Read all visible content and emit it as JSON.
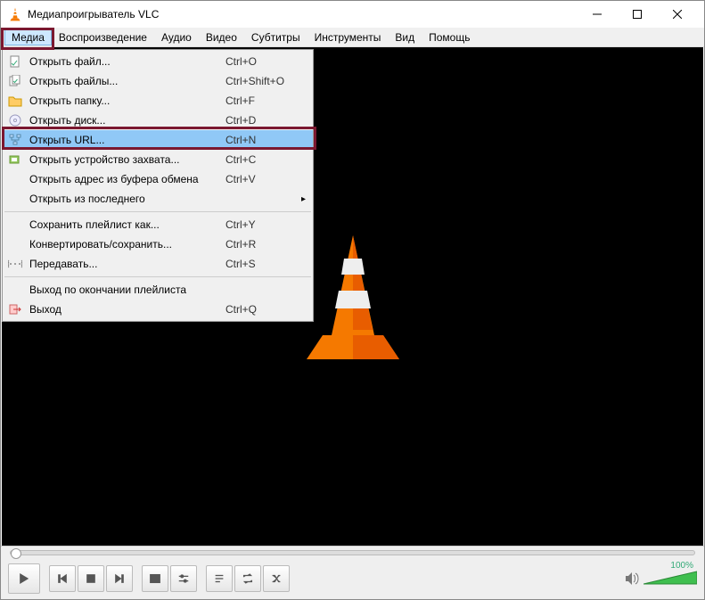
{
  "titlebar": {
    "title": "Медиапроигрыватель VLC"
  },
  "menubar": {
    "items": [
      {
        "label": "Медиа",
        "open": true
      },
      {
        "label": "Воспроизведение"
      },
      {
        "label": "Аудио"
      },
      {
        "label": "Видео"
      },
      {
        "label": "Субтитры"
      },
      {
        "label": "Инструменты"
      },
      {
        "label": "Вид"
      },
      {
        "label": "Помощь"
      }
    ]
  },
  "dropdown": {
    "items": [
      {
        "icon": "file",
        "label": "Открыть файл...",
        "shortcut": "Ctrl+O"
      },
      {
        "icon": "files",
        "label": "Открыть файлы...",
        "shortcut": "Ctrl+Shift+O"
      },
      {
        "icon": "folder",
        "label": "Открыть папку...",
        "shortcut": "Ctrl+F"
      },
      {
        "icon": "disc",
        "label": "Открыть диск...",
        "shortcut": "Ctrl+D"
      },
      {
        "icon": "network",
        "label": "Открыть URL...",
        "shortcut": "Ctrl+N",
        "hover": true,
        "highlighted": true
      },
      {
        "icon": "capture",
        "label": "Открыть устройство захвата...",
        "shortcut": "Ctrl+C"
      },
      {
        "icon": "",
        "label": "Открыть адрес из буфера обмена",
        "shortcut": "Ctrl+V"
      },
      {
        "icon": "",
        "label": "Открыть из последнего",
        "shortcut": "",
        "submenu": true
      },
      {
        "sep": true
      },
      {
        "icon": "",
        "label": "Сохранить плейлист как...",
        "shortcut": "Ctrl+Y"
      },
      {
        "icon": "",
        "label": "Конвертировать/сохранить...",
        "shortcut": "Ctrl+R"
      },
      {
        "icon": "stream",
        "label": "Передавать...",
        "shortcut": "Ctrl+S"
      },
      {
        "sep": true
      },
      {
        "icon": "",
        "label": "Выход по окончании плейлиста",
        "shortcut": ""
      },
      {
        "icon": "exit",
        "label": "Выход",
        "shortcut": "Ctrl+Q"
      }
    ]
  },
  "volume": {
    "percent": "100%"
  }
}
